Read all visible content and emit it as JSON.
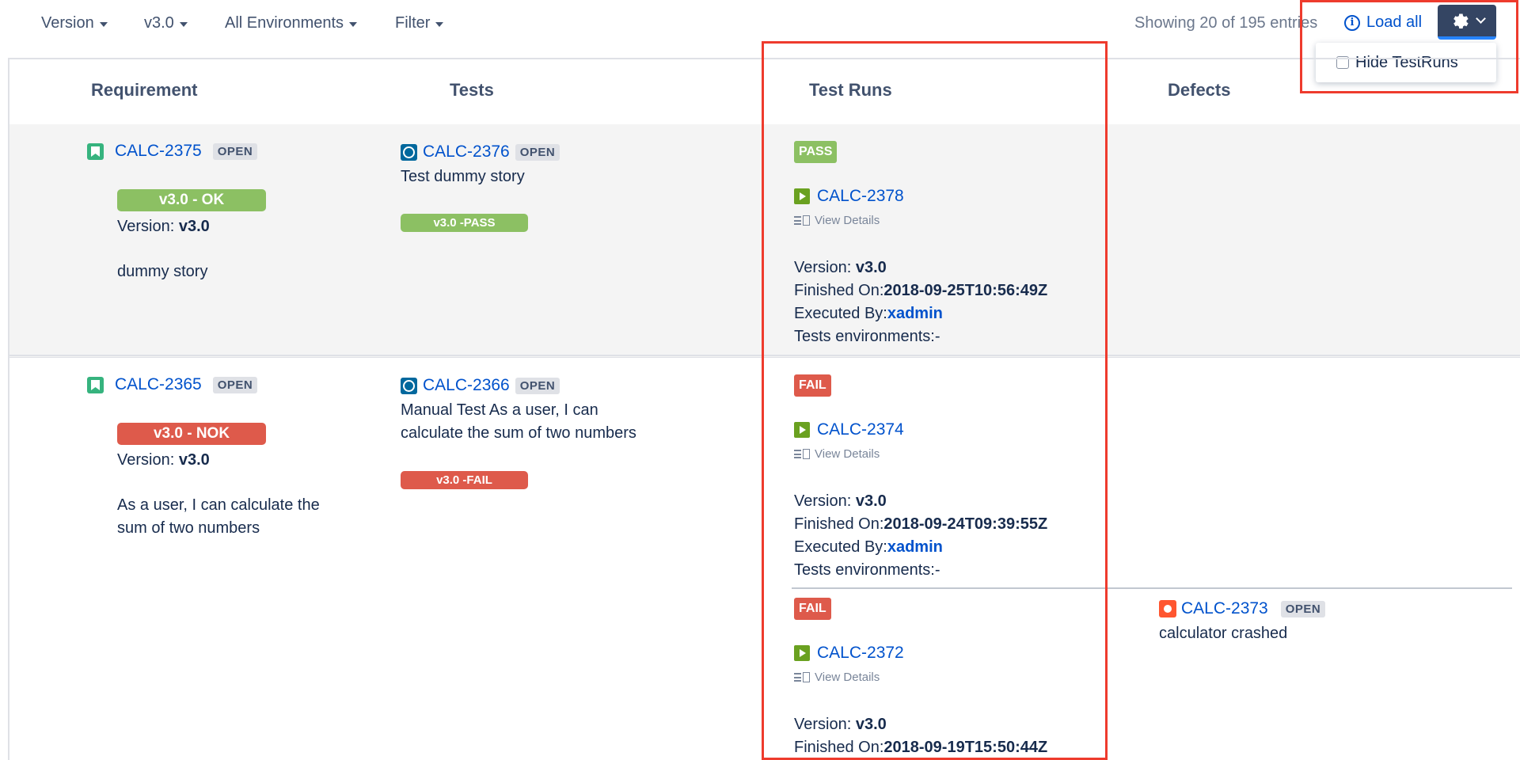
{
  "toolbar": {
    "filters": [
      {
        "label": "Version"
      },
      {
        "label": "v3.0"
      },
      {
        "label": "All Environments"
      },
      {
        "label": "Filter"
      }
    ],
    "showing": "Showing 20 of 195 entries",
    "load_all": "Load all",
    "settings_icon": "gear-icon",
    "dropdown": {
      "option": "Hide TestRuns",
      "checked": false
    }
  },
  "columns": [
    "Requirement",
    "Tests",
    "Test Runs",
    "Defects"
  ],
  "rows": [
    {
      "requirement": {
        "key": "CALC-2375",
        "status": "OPEN",
        "coverage": "v3.0 - OK",
        "version_label": "Version: ",
        "version": "v3.0",
        "summary": "dummy story"
      },
      "test": {
        "key": "CALC-2376",
        "status": "OPEN",
        "summary": "Test dummy story",
        "result": "v3.0 -PASS"
      },
      "runs": [
        {
          "status": "PASS",
          "key": "CALC-2378",
          "view_details": "View Details",
          "version_label": "Version: ",
          "version": "v3.0",
          "finished_label": "Finished On:",
          "finished": "2018-09-25T10:56:49Z",
          "executed_label": "Executed By:",
          "executed_by": "xadmin",
          "env": "Tests environments:-"
        }
      ]
    },
    {
      "requirement": {
        "key": "CALC-2365",
        "status": "OPEN",
        "coverage": "v3.0 - NOK",
        "version_label": "Version: ",
        "version": "v3.0",
        "summary_line1": "As a user, I can calculate the",
        "summary_line2": "sum of two numbers"
      },
      "test": {
        "key": "CALC-2366",
        "status": "OPEN",
        "summary_line1": "Manual Test As a user, I can",
        "summary_line2": "calculate the sum of two numbers",
        "result": "v3.0 -FAIL"
      },
      "runs": [
        {
          "status": "FAIL",
          "key": "CALC-2374",
          "view_details": "View Details",
          "version_label": "Version: ",
          "version": "v3.0",
          "finished_label": "Finished On:",
          "finished": "2018-09-24T09:39:55Z",
          "executed_label": "Executed By:",
          "executed_by": "xadmin",
          "env": "Tests environments:-"
        },
        {
          "status": "FAIL",
          "key": "CALC-2372",
          "view_details": "View Details",
          "version_label": "Version: ",
          "version": "v3.0",
          "finished_label": "Finished On:",
          "finished": "2018-09-19T15:50:44Z"
        }
      ],
      "defect": {
        "key": "CALC-2373",
        "status": "OPEN",
        "summary": "calculator crashed"
      }
    }
  ],
  "colors": {
    "pass": "#8cc063",
    "fail": "#de5a4b",
    "link": "#0052cc",
    "highlight": "#ee3b2d",
    "settings_bg": "#344563"
  }
}
